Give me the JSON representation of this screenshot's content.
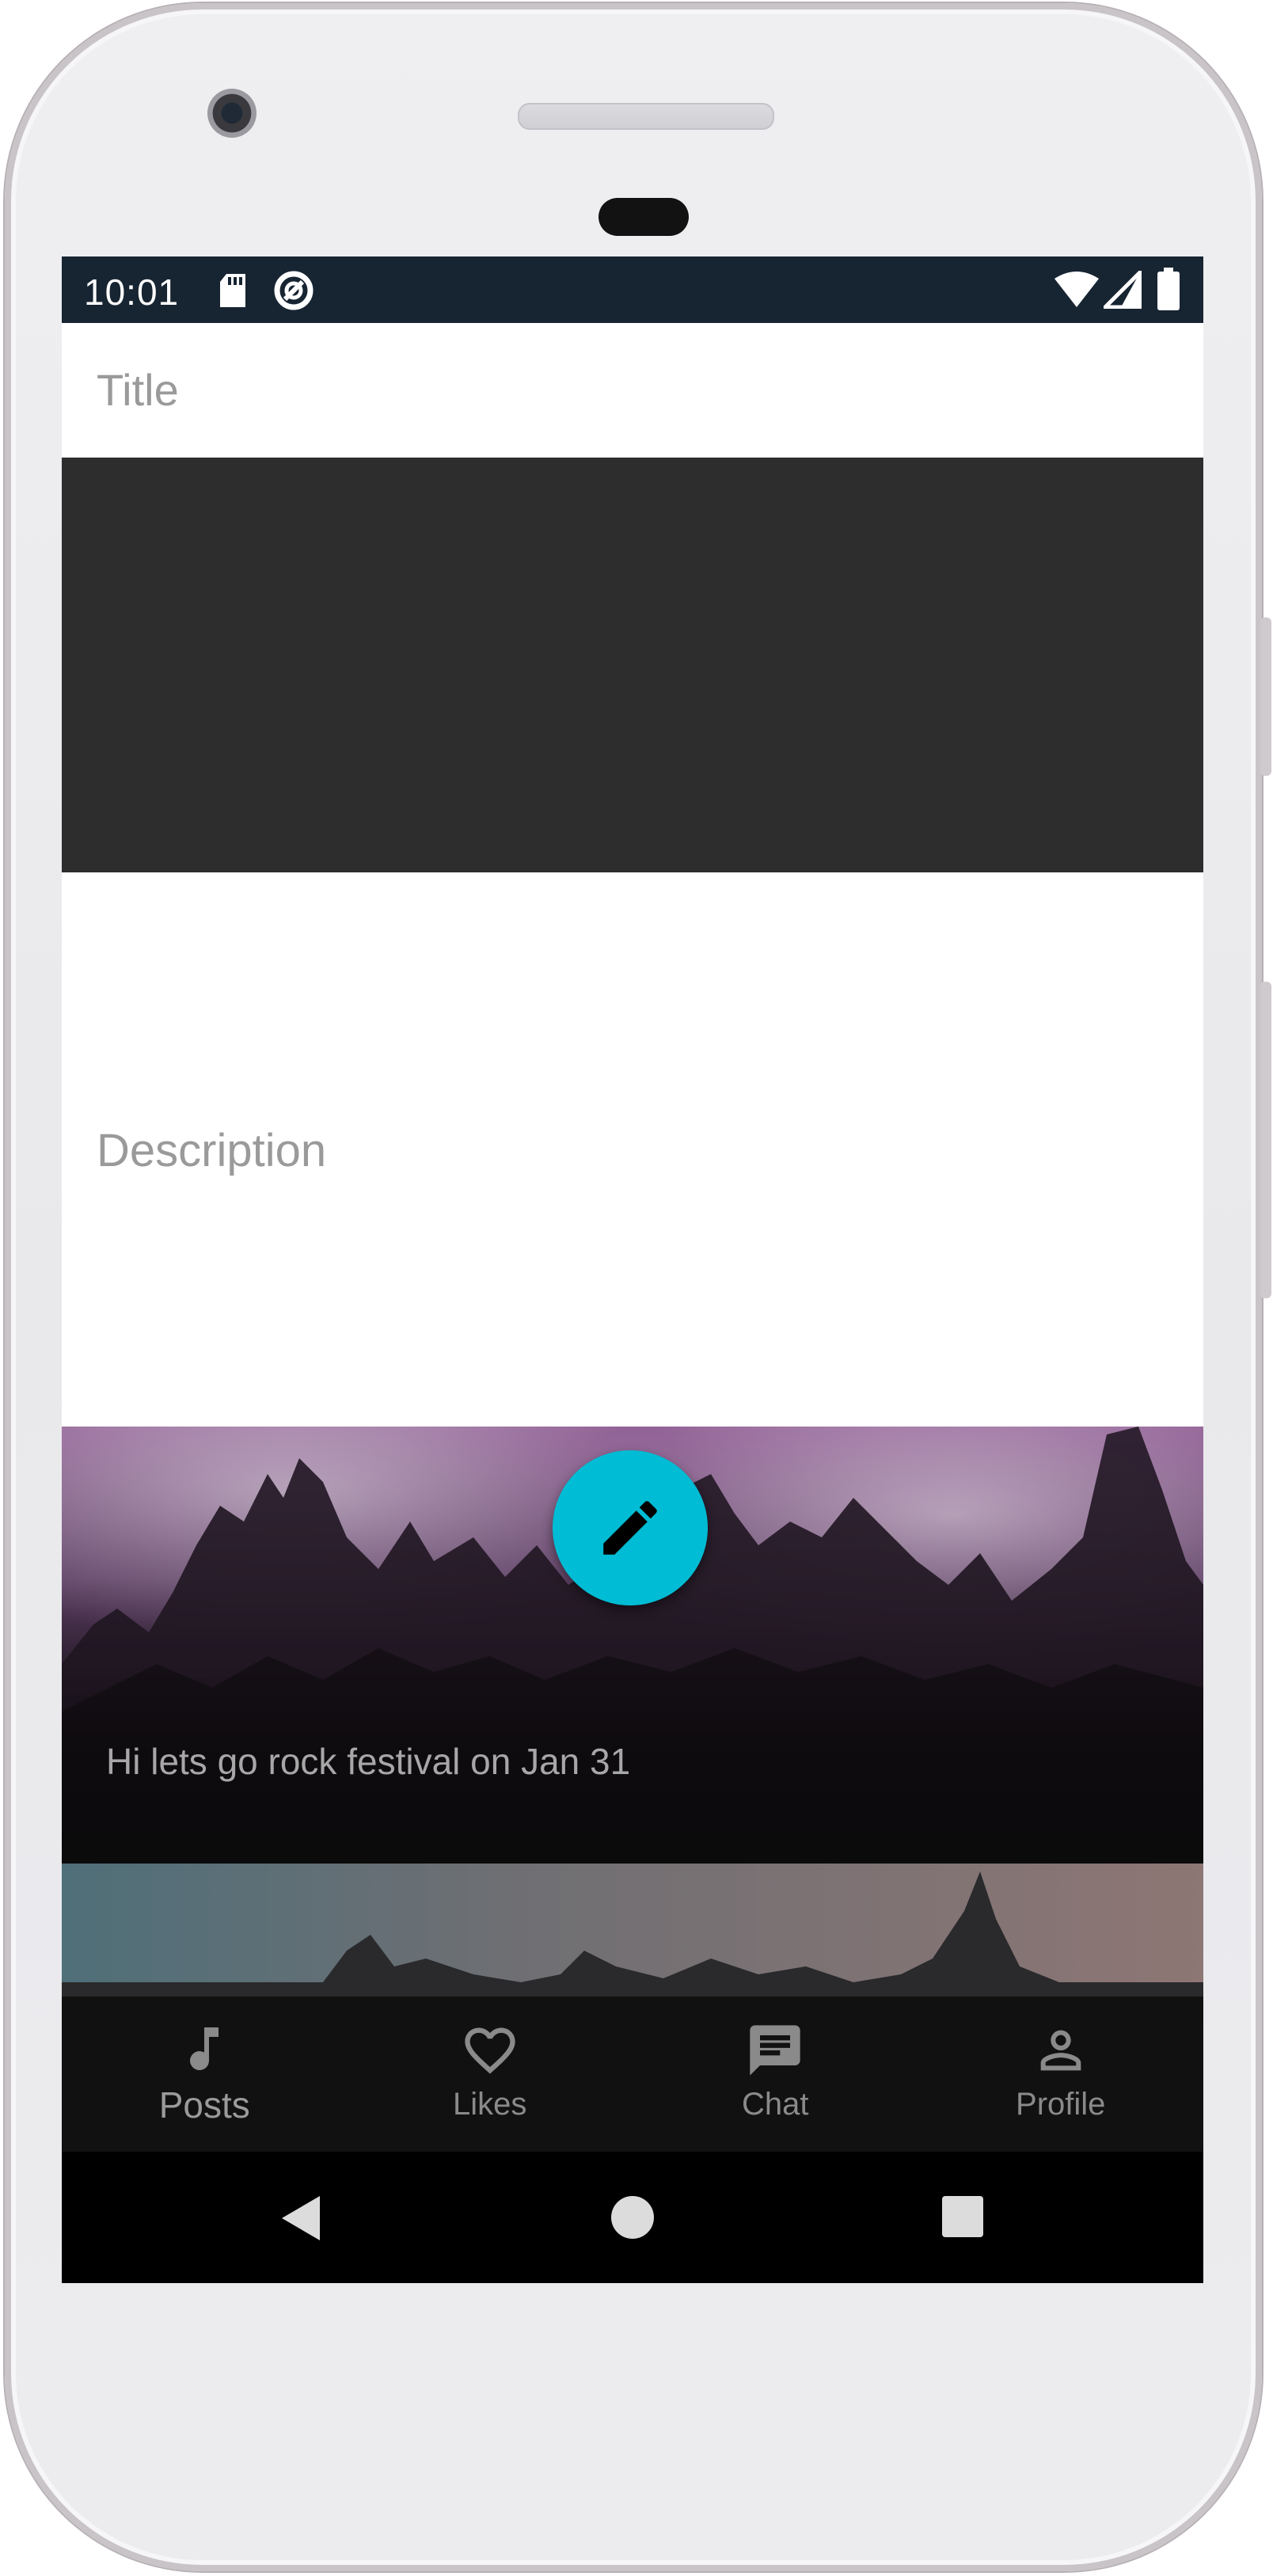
{
  "status_bar": {
    "time": "10:01",
    "icons": [
      "sd-card-icon",
      "data-saver-icon",
      "wifi-icon",
      "cell-signal-icon",
      "battery-icon"
    ]
  },
  "form": {
    "title_placeholder": "Title",
    "description_placeholder": "Description"
  },
  "posts": [
    {
      "text": "Hi lets go rock festival on Jan 31"
    },
    {
      "text": ""
    }
  ],
  "fab": {
    "icon": "pencil-icon",
    "color": "#00bcd4"
  },
  "bottom_nav": {
    "items": [
      {
        "label": "Posts",
        "icon": "music-note-icon",
        "active": true
      },
      {
        "label": "Likes",
        "icon": "heart-icon",
        "active": false
      },
      {
        "label": "Chat",
        "icon": "chat-bubble-icon",
        "active": false
      },
      {
        "label": "Profile",
        "icon": "person-icon",
        "active": false
      }
    ]
  },
  "system_nav": {
    "icons": [
      "back-icon",
      "home-icon",
      "recents-icon"
    ]
  },
  "colors": {
    "status_bar": "#172432",
    "accent": "#00bcd4",
    "nav_background": "#111111",
    "placeholder_text": "#9a9a9a"
  }
}
